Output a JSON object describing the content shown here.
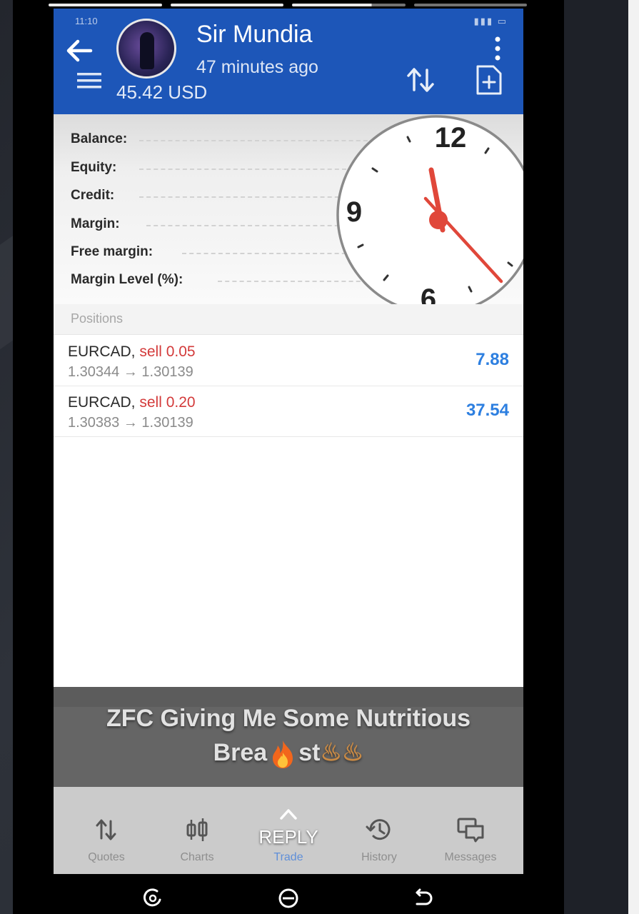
{
  "post": {
    "poster_name": "Sir Mundia",
    "poster_time": "47 minutes ago"
  },
  "status_bar": {
    "time": "11:10"
  },
  "account": {
    "balance_amount": "45.42 USD",
    "rows": [
      {
        "label": "Balance:"
      },
      {
        "label": "Equity:"
      },
      {
        "label": "Credit:"
      },
      {
        "label": "Margin:"
      },
      {
        "label": "Free margin:"
      },
      {
        "label": "Margin Level (%):"
      }
    ]
  },
  "clock": {
    "numerals": {
      "twelve": "12",
      "nine": "9",
      "six": "6"
    }
  },
  "positions": {
    "header": "Positions",
    "items": [
      {
        "symbol": "EURCAD,",
        "side": "sell 0.05",
        "prices": "1.30344 → 1.30139",
        "profit": "7.88"
      },
      {
        "symbol": "EURCAD,",
        "side": "sell 0.20",
        "prices": "1.30383 → 1.30139",
        "profit": "37.54"
      }
    ]
  },
  "caption": {
    "line1": "ZFC Giving Me Some Nutritious",
    "line2_start": "Brea",
    "line2_end": "st"
  },
  "bottom_nav": {
    "items": [
      {
        "label": "Quotes",
        "icon": "quotes-arrows-icon"
      },
      {
        "label": "Charts",
        "icon": "candlestick-icon"
      },
      {
        "label": "Trade",
        "icon": "trade-icon",
        "active": true
      },
      {
        "label": "History",
        "icon": "history-clock-icon"
      },
      {
        "label": "Messages",
        "icon": "messages-icon"
      }
    ],
    "reply_label": "REPLY"
  },
  "colors": {
    "header_blue": "#1d56b8",
    "sell_red": "#d33a3a",
    "profit_blue": "#2d7fe0",
    "clock_hand_red": "#e0473a"
  }
}
